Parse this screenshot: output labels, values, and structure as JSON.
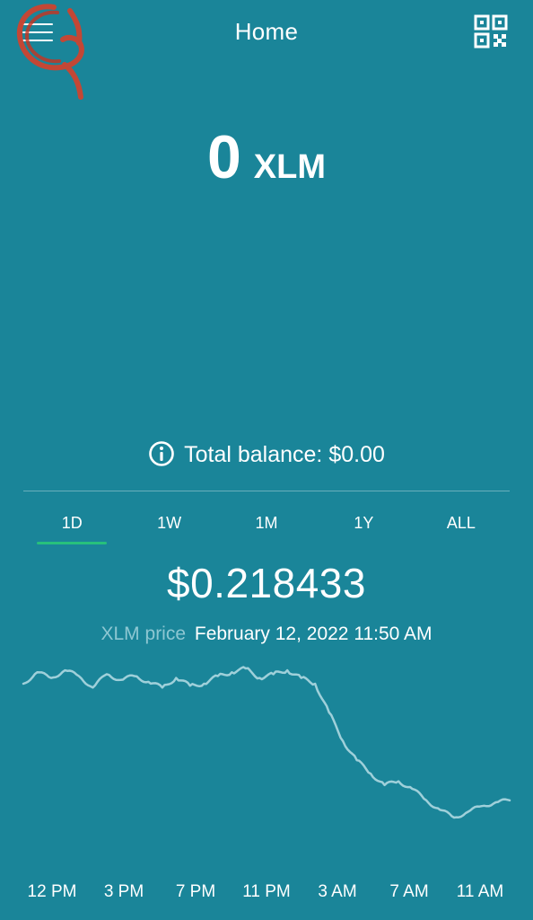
{
  "header": {
    "title": "Home",
    "menu_icon": "hamburger-menu-icon",
    "qr_icon": "qr-code-icon"
  },
  "balance": {
    "amount": "0",
    "unit": "XLM"
  },
  "total": {
    "icon": "info-icon",
    "text": "Total balance: $0.00"
  },
  "tabs": [
    {
      "label": "1D",
      "active": true
    },
    {
      "label": "1W",
      "active": false
    },
    {
      "label": "1M",
      "active": false
    },
    {
      "label": "1Y",
      "active": false
    },
    {
      "label": "ALL",
      "active": false
    }
  ],
  "price": {
    "value": "$0.218433",
    "label": "XLM price",
    "datetime": "February 12, 2022 11:50 AM"
  },
  "chart_data": {
    "type": "line",
    "x": [
      "12 PM",
      "3 PM",
      "7 PM",
      "11 PM",
      "3 AM",
      "7 AM",
      "11 AM"
    ],
    "series": [
      {
        "values": [
          0.2245,
          0.2251,
          0.2248,
          0.2252,
          0.2249,
          0.2243,
          0.225,
          0.2247,
          0.2249,
          0.2246,
          0.2243,
          0.2248,
          0.2244,
          0.2245,
          0.2249,
          0.2251,
          0.2253,
          0.2248,
          0.225,
          0.2252,
          0.2248,
          0.2245,
          0.223,
          0.2215,
          0.2205,
          0.2198,
          0.2192,
          0.2194,
          0.219,
          0.2184,
          0.2179,
          0.2175,
          0.2178,
          0.2181,
          0.2183,
          0.2184
        ]
      }
    ],
    "colors": {
      "line": "#9fd0da",
      "accent": "#27c07c",
      "background": "#1a8599"
    }
  }
}
